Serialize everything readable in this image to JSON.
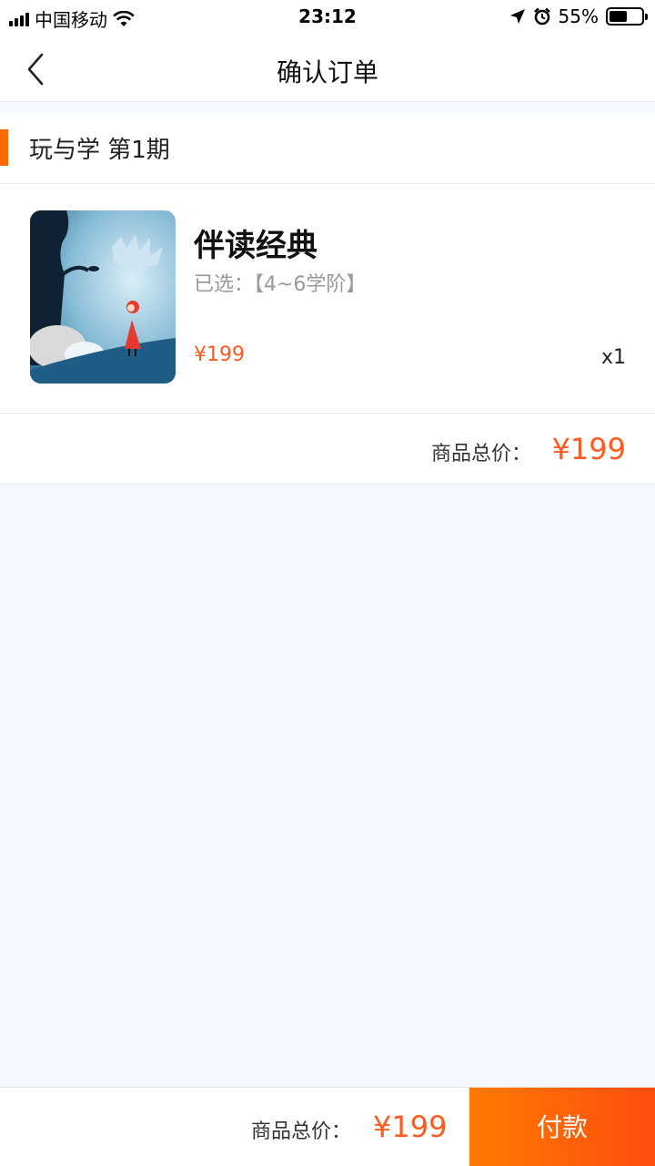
{
  "status_bar": {
    "carrier": "中国移动",
    "time": "23:12",
    "battery_percent": "55%",
    "battery_level": 0.55,
    "icons": [
      "signal-icon",
      "wifi-icon",
      "location-icon",
      "alarm-icon",
      "battery-icon"
    ]
  },
  "nav": {
    "title": "确认订单",
    "back_icon": "chevron-left-icon"
  },
  "store": {
    "name": "玩与学 第1期",
    "accent_color": "#ff6a00"
  },
  "product": {
    "name": "伴读经典",
    "spec": "已选：【4~6学阶】",
    "price": "¥199",
    "quantity": "x1"
  },
  "subtotal": {
    "label": "商品总价：",
    "value": "¥199"
  },
  "footer": {
    "total_label": "商品总价：",
    "total_value": "¥199",
    "pay_label": "付款"
  },
  "colors": {
    "price": "#ff5a1f",
    "pay_gradient_start": "#ff7a00",
    "pay_gradient_end": "#ff4d0f",
    "page_background": "#f5f8fe"
  }
}
